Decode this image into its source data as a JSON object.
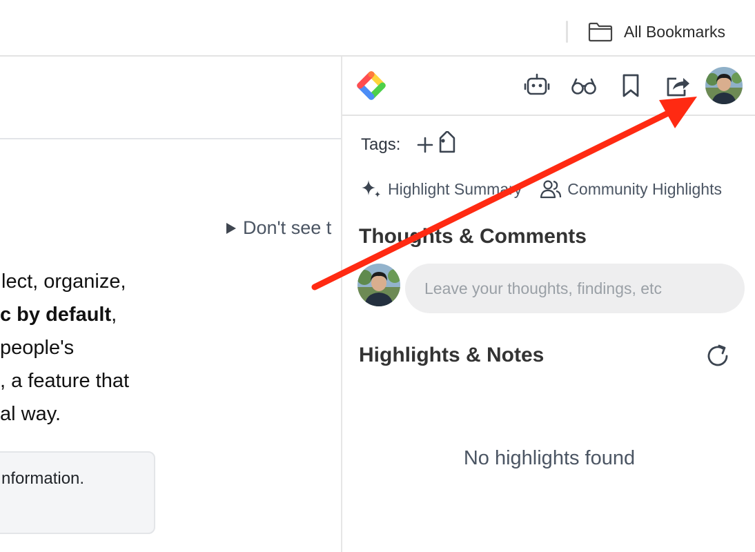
{
  "bookmarks_bar": {
    "all_bookmarks_label": "All Bookmarks",
    "folder_icon": "folder-icon"
  },
  "page": {
    "disclosure_text": "Don't see t",
    "text_lines": [
      {
        "pre": "lect, organize,",
        "bold": "",
        "post": ""
      },
      {
        "pre": "",
        "bold": "c by default",
        "post": ","
      },
      {
        "pre": "people's",
        "bold": "",
        "post": ""
      },
      {
        "pre": ", a feature that",
        "bold": "",
        "post": ""
      },
      {
        "pre": "al way.",
        "bold": "",
        "post": ""
      }
    ],
    "box_text": "nformation."
  },
  "panel": {
    "header_icons": [
      "logo-icon",
      "robot-icon",
      "glasses-icon",
      "bookmark-icon",
      "share-icon",
      "user-avatar"
    ],
    "tags_label": "Tags:",
    "add_tag_icon": "add-tag-icon",
    "highlight_summary_label": "Highlight Summary",
    "community_highlights_label": "Community Highlights",
    "thoughts_title": "Thoughts & Comments",
    "comment_placeholder": "Leave your thoughts, findings, etc",
    "highlights_title": "Highlights & Notes",
    "refresh_icon": "refresh-icon",
    "empty_message": "No highlights found"
  },
  "colors": {
    "annotation_arrow": "#ff2a12",
    "logo": [
      "#ff4d4f",
      "#ffd43b",
      "#4dd04a",
      "#4c8df6"
    ]
  }
}
